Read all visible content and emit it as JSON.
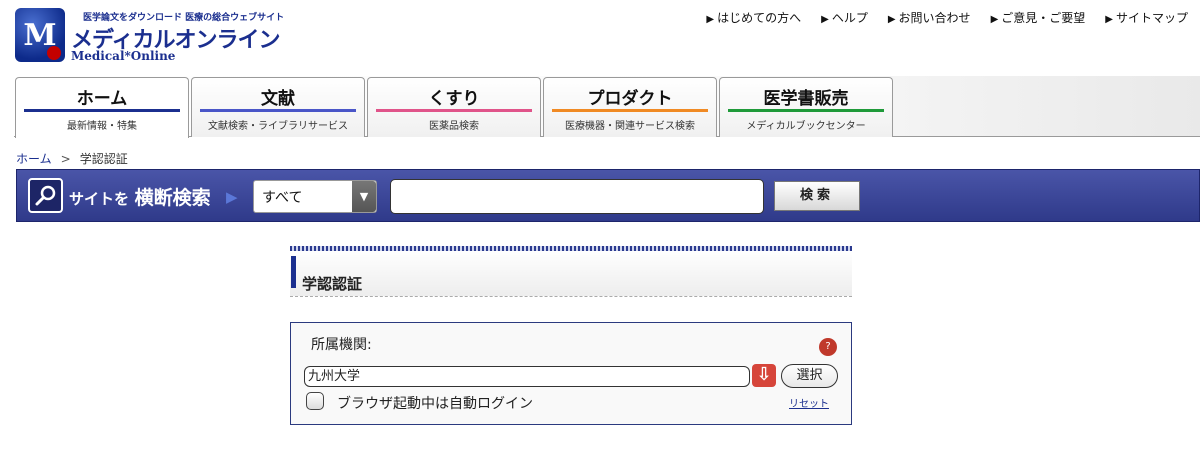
{
  "header": {
    "logo_tagline": "医学論文をダウンロード 医療の総合ウェブサイト",
    "logo_title": "メディカルオンライン",
    "logo_subtitle": "Medical*Online",
    "logo_mark": "M",
    "utility_links": [
      "はじめての方へ",
      "ヘルプ",
      "お問い合わせ",
      "ご意見・ご要望",
      "サイトマップ"
    ]
  },
  "nav": {
    "tabs": [
      {
        "label": "ホーム",
        "sub": "最新情報・特集",
        "color": "#1b2f8f"
      },
      {
        "label": "文献",
        "sub": "文献検索・ライブラリサービス",
        "color": "#4a56c8"
      },
      {
        "label": "くすり",
        "sub": "医薬品検索",
        "color": "#e0548a"
      },
      {
        "label": "プロダクト",
        "sub": "医療機器・関連サービス検索",
        "color": "#f08a24"
      },
      {
        "label": "医学書販売",
        "sub": "メディカルブックセンター",
        "color": "#1f9a3a"
      }
    ]
  },
  "breadcrumb": {
    "home": "ホーム",
    "separator": ">",
    "current": "学認認証"
  },
  "search": {
    "title_small_1": "サイトを",
    "title_big": "横断検索",
    "scope_selected": "すべて",
    "query": "",
    "button_label": "検索"
  },
  "content": {
    "heading": "学認認証",
    "institution_label": "所属機関:",
    "institution_value": "九州大学",
    "help_icon_text": "?",
    "select_label": "選択",
    "auto_login_label": "ブラウザ起動中は自動ログイン",
    "reset_label": "リセット"
  }
}
